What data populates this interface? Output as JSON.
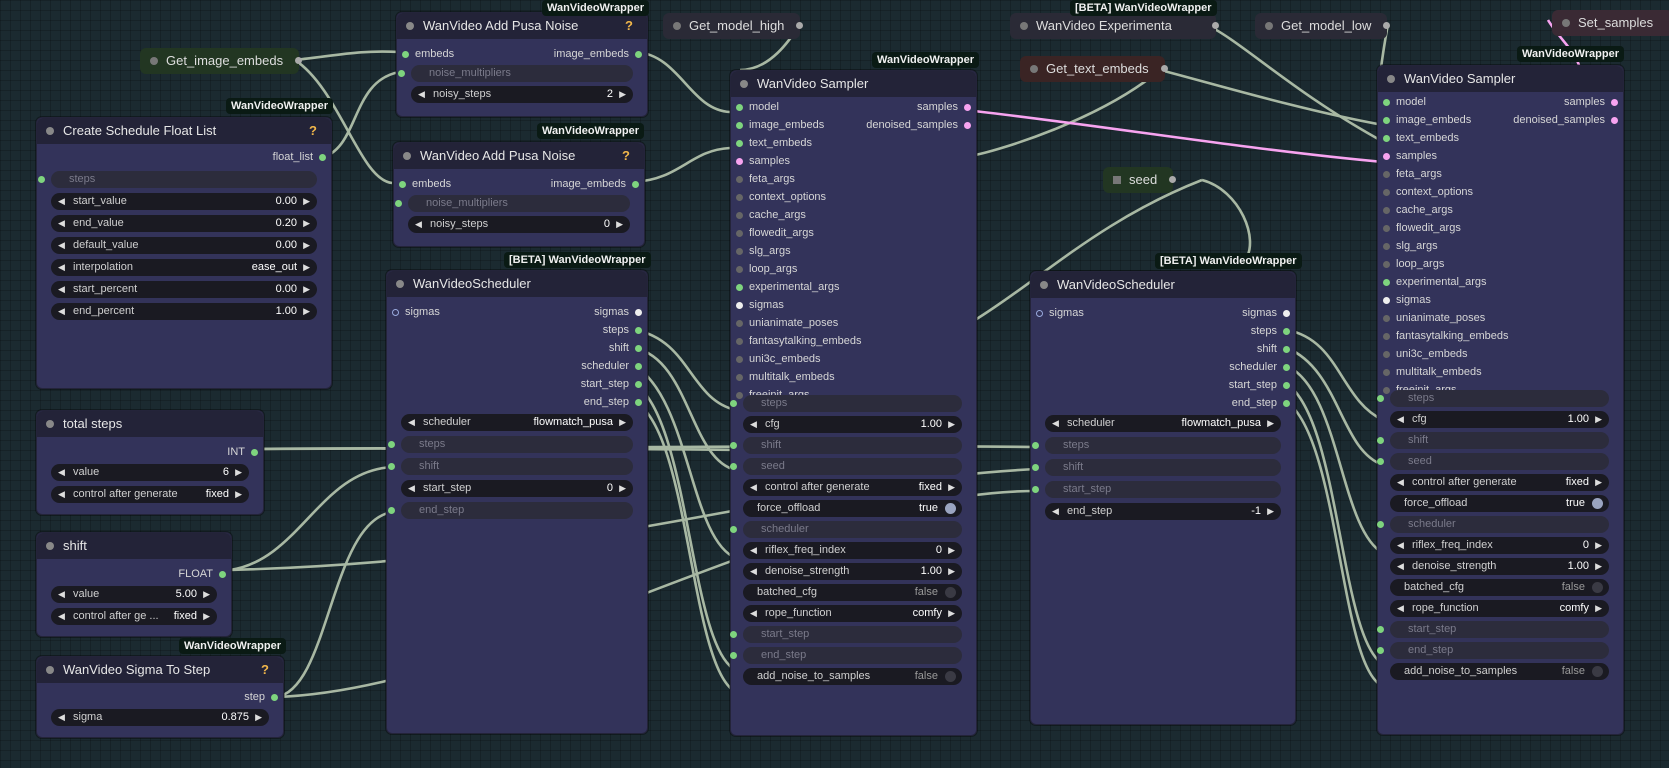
{
  "colors": {
    "canvas": "#1b2a30",
    "node": "#33335a",
    "title": "#232338",
    "pin": "#7ed47e",
    "samples_wire": "#f7a3f0",
    "wire": "#b8c8b0",
    "help": "#f0b64a"
  },
  "badges": {
    "pusa1": "WanVideoWrapper",
    "pusa2": "WanVideoWrapper",
    "schedule": "WanVideoWrapper",
    "sampler1": "WanVideoWrapper",
    "sampler2": "WanVideoWrapper",
    "scheduler1": "[BETA] WanVideoWrapper",
    "scheduler2": "[BETA] WanVideoWrapper",
    "sigma": "WanVideoWrapper",
    "exp_top": "[BETA] WanVideoWrapper"
  },
  "get_image_embeds": "Get_image_embeds",
  "get_model_high": "Get_model_high",
  "get_model_low": "Get_model_low",
  "get_text_embeds": "Get_text_embeds",
  "set_samples": "Set_samples",
  "experimental": "WanVideo Experimenta",
  "seed_node": "seed",
  "help_mark": "?",
  "pusa1": {
    "title": "WanVideo Add Pusa Noise",
    "in": "embeds",
    "out": "image_embeds",
    "noise_multipliers": "noise_multipliers",
    "noisy_label": "noisy_steps",
    "noisy_value": "2"
  },
  "pusa2": {
    "title": "WanVideo Add Pusa Noise",
    "in": "embeds",
    "out": "image_embeds",
    "noise_multipliers": "noise_multipliers",
    "noisy_label": "noisy_steps",
    "noisy_value": "0"
  },
  "schedule": {
    "title": "Create Schedule Float List",
    "out": "float_list",
    "steps": "steps",
    "widgets": [
      {
        "label": "start_value",
        "value": "0.00"
      },
      {
        "label": "end_value",
        "value": "0.20"
      },
      {
        "label": "default_value",
        "value": "0.00"
      },
      {
        "label": "interpolation",
        "value": "ease_out"
      },
      {
        "label": "start_percent",
        "value": "0.00"
      },
      {
        "label": "end_percent",
        "value": "1.00"
      }
    ]
  },
  "total_steps": {
    "title": "total steps",
    "out": "INT",
    "value_label": "value",
    "value": "6",
    "control_label": "control after generate",
    "control_value": "fixed"
  },
  "shift": {
    "title": "shift",
    "out": "FLOAT",
    "value_label": "value",
    "value": "5.00",
    "control_label": "control after ge ...",
    "control_value": "fixed"
  },
  "sigma_to_step": {
    "title": "WanVideo Sigma To Step",
    "out": "step",
    "sigma_label": "sigma",
    "sigma_value": "0.875"
  },
  "scheduler1": {
    "title": "WanVideoScheduler",
    "in": "sigmas",
    "outs": [
      "sigmas",
      "steps",
      "shift",
      "scheduler",
      "start_step",
      "end_step"
    ],
    "sched_label": "scheduler",
    "sched_value": "flowmatch_pusa",
    "steps": "steps",
    "shift_in": "shift",
    "start_label": "start_step",
    "start_value": "0",
    "end_step": "end_step"
  },
  "scheduler2": {
    "title": "WanVideoScheduler",
    "in": "sigmas",
    "outs": [
      "sigmas",
      "steps",
      "shift",
      "scheduler",
      "start_step",
      "end_step"
    ],
    "sched_label": "scheduler",
    "sched_value": "flowmatch_pusa",
    "steps": "steps",
    "shift_in": "shift",
    "start_step": "start_step",
    "end_label": "end_step",
    "end_value": "-1"
  },
  "sampler1": {
    "title": "WanVideo Sampler",
    "inputs": [
      "model",
      "image_embeds",
      "text_embeds",
      "samples",
      "feta_args",
      "context_options",
      "cache_args",
      "flowedit_args",
      "slg_args",
      "loop_args",
      "experimental_args",
      "sigmas",
      "unianimate_poses",
      "fantasytalking_embeds",
      "uni3c_embeds",
      "multitalk_embeds",
      "freeinit_args"
    ],
    "outputs": [
      "samples",
      "denoised_samples"
    ],
    "steps": "steps",
    "cfg_label": "cfg",
    "cfg_value": "1.00",
    "shift": "shift",
    "seed": "seed",
    "control_label": "control after generate",
    "control_value": "fixed",
    "force_label": "force_offload",
    "force_value": "true",
    "scheduler": "scheduler",
    "riflex_label": "riflex_freq_index",
    "riflex_value": "0",
    "denoise_label": "denoise_strength",
    "denoise_value": "1.00",
    "batched_label": "batched_cfg",
    "batched_value": "false",
    "rope_label": "rope_function",
    "rope_value": "comfy",
    "start_step": "start_step",
    "end_step": "end_step",
    "add_noise_label": "add_noise_to_samples",
    "add_noise_value": "false"
  },
  "sampler2": {
    "title": "WanVideo Sampler",
    "inputs": [
      "model",
      "image_embeds",
      "text_embeds",
      "samples",
      "feta_args",
      "context_options",
      "cache_args",
      "flowedit_args",
      "slg_args",
      "loop_args",
      "experimental_args",
      "sigmas",
      "unianimate_poses",
      "fantasytalking_embeds",
      "uni3c_embeds",
      "multitalk_embeds",
      "freeinit_args"
    ],
    "outputs": [
      "samples",
      "denoised_samples"
    ],
    "steps": "steps",
    "cfg_label": "cfg",
    "cfg_value": "1.00",
    "shift": "shift",
    "seed": "seed",
    "control_label": "control after generate",
    "control_value": "fixed",
    "force_label": "force_offload",
    "force_value": "true",
    "scheduler": "scheduler",
    "riflex_label": "riflex_freq_index",
    "riflex_value": "0",
    "denoise_label": "denoise_strength",
    "denoise_value": "1.00",
    "batched_label": "batched_cfg",
    "batched_value": "false",
    "rope_label": "rope_function",
    "rope_value": "comfy",
    "start_step": "start_step",
    "end_step": "end_step",
    "add_noise_label": "add_noise_to_samples",
    "add_noise_value": "false"
  }
}
